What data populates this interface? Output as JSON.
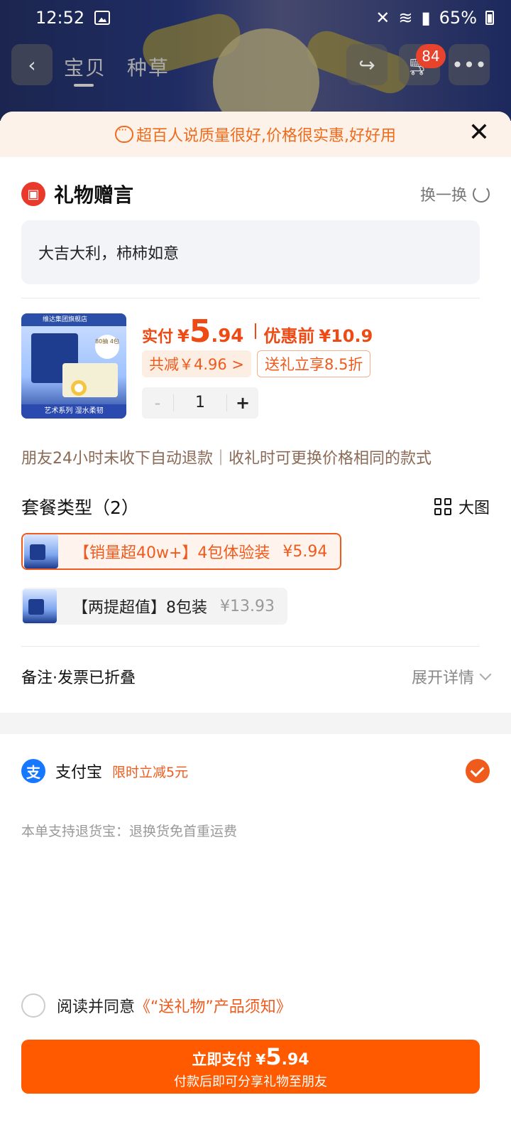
{
  "status_bar": {
    "time": "12:52",
    "battery": "65%"
  },
  "nav": {
    "tabs": [
      "宝贝",
      "种草"
    ],
    "cart_badge": "84"
  },
  "banner": {
    "text": "超百人说质量很好,价格很实惠,好好用"
  },
  "gift": {
    "title": "礼物赠言",
    "swap_label": "换一换",
    "message": "大吉大利，柿柿如意"
  },
  "product": {
    "price_label": "实付",
    "currency": "¥",
    "price_int": "5",
    "price_dec": ".94",
    "before_label": "优惠前",
    "before_price": "¥10.9",
    "discount_tag": "共减￥4.96 >",
    "gift_tag": "送礼立享8.5折",
    "quantity": "1",
    "minus": "-",
    "plus": "+",
    "image_texts": {
      "store": "维达集团旗舰店",
      "badge": "80抽 4包",
      "footer": "艺术系列 湿水柔韧"
    }
  },
  "notice": "朋友24小时未收下自动退款｜收礼时可更换价格相同的款式",
  "packages": {
    "title": "套餐类型（2）",
    "big_view": "大图",
    "options": [
      {
        "label": "【销量超40w+】4包体验装",
        "price": "¥5.94",
        "selected": true
      },
      {
        "label": "【两提超值】8包装",
        "price": "¥13.93",
        "selected": false
      }
    ]
  },
  "remark": {
    "title": "备注·发票已折叠",
    "expand": "展开详情"
  },
  "payment": {
    "icon_char": "支",
    "name": "支付宝",
    "promo": "限时立减5元",
    "returns": "本单支持退货宝：退换货免首重运费"
  },
  "agreement": {
    "text": "阅读并同意",
    "link": "《“送礼物”产品须知》"
  },
  "pay_button": {
    "label": "立即支付",
    "currency": "¥",
    "int": "5",
    "dec": ".94",
    "sub": "付款后即可分享礼物至朋友"
  },
  "colors": {
    "accent": "#ff5a00",
    "price": "#ee4a14",
    "alipay": "#1677ff"
  }
}
